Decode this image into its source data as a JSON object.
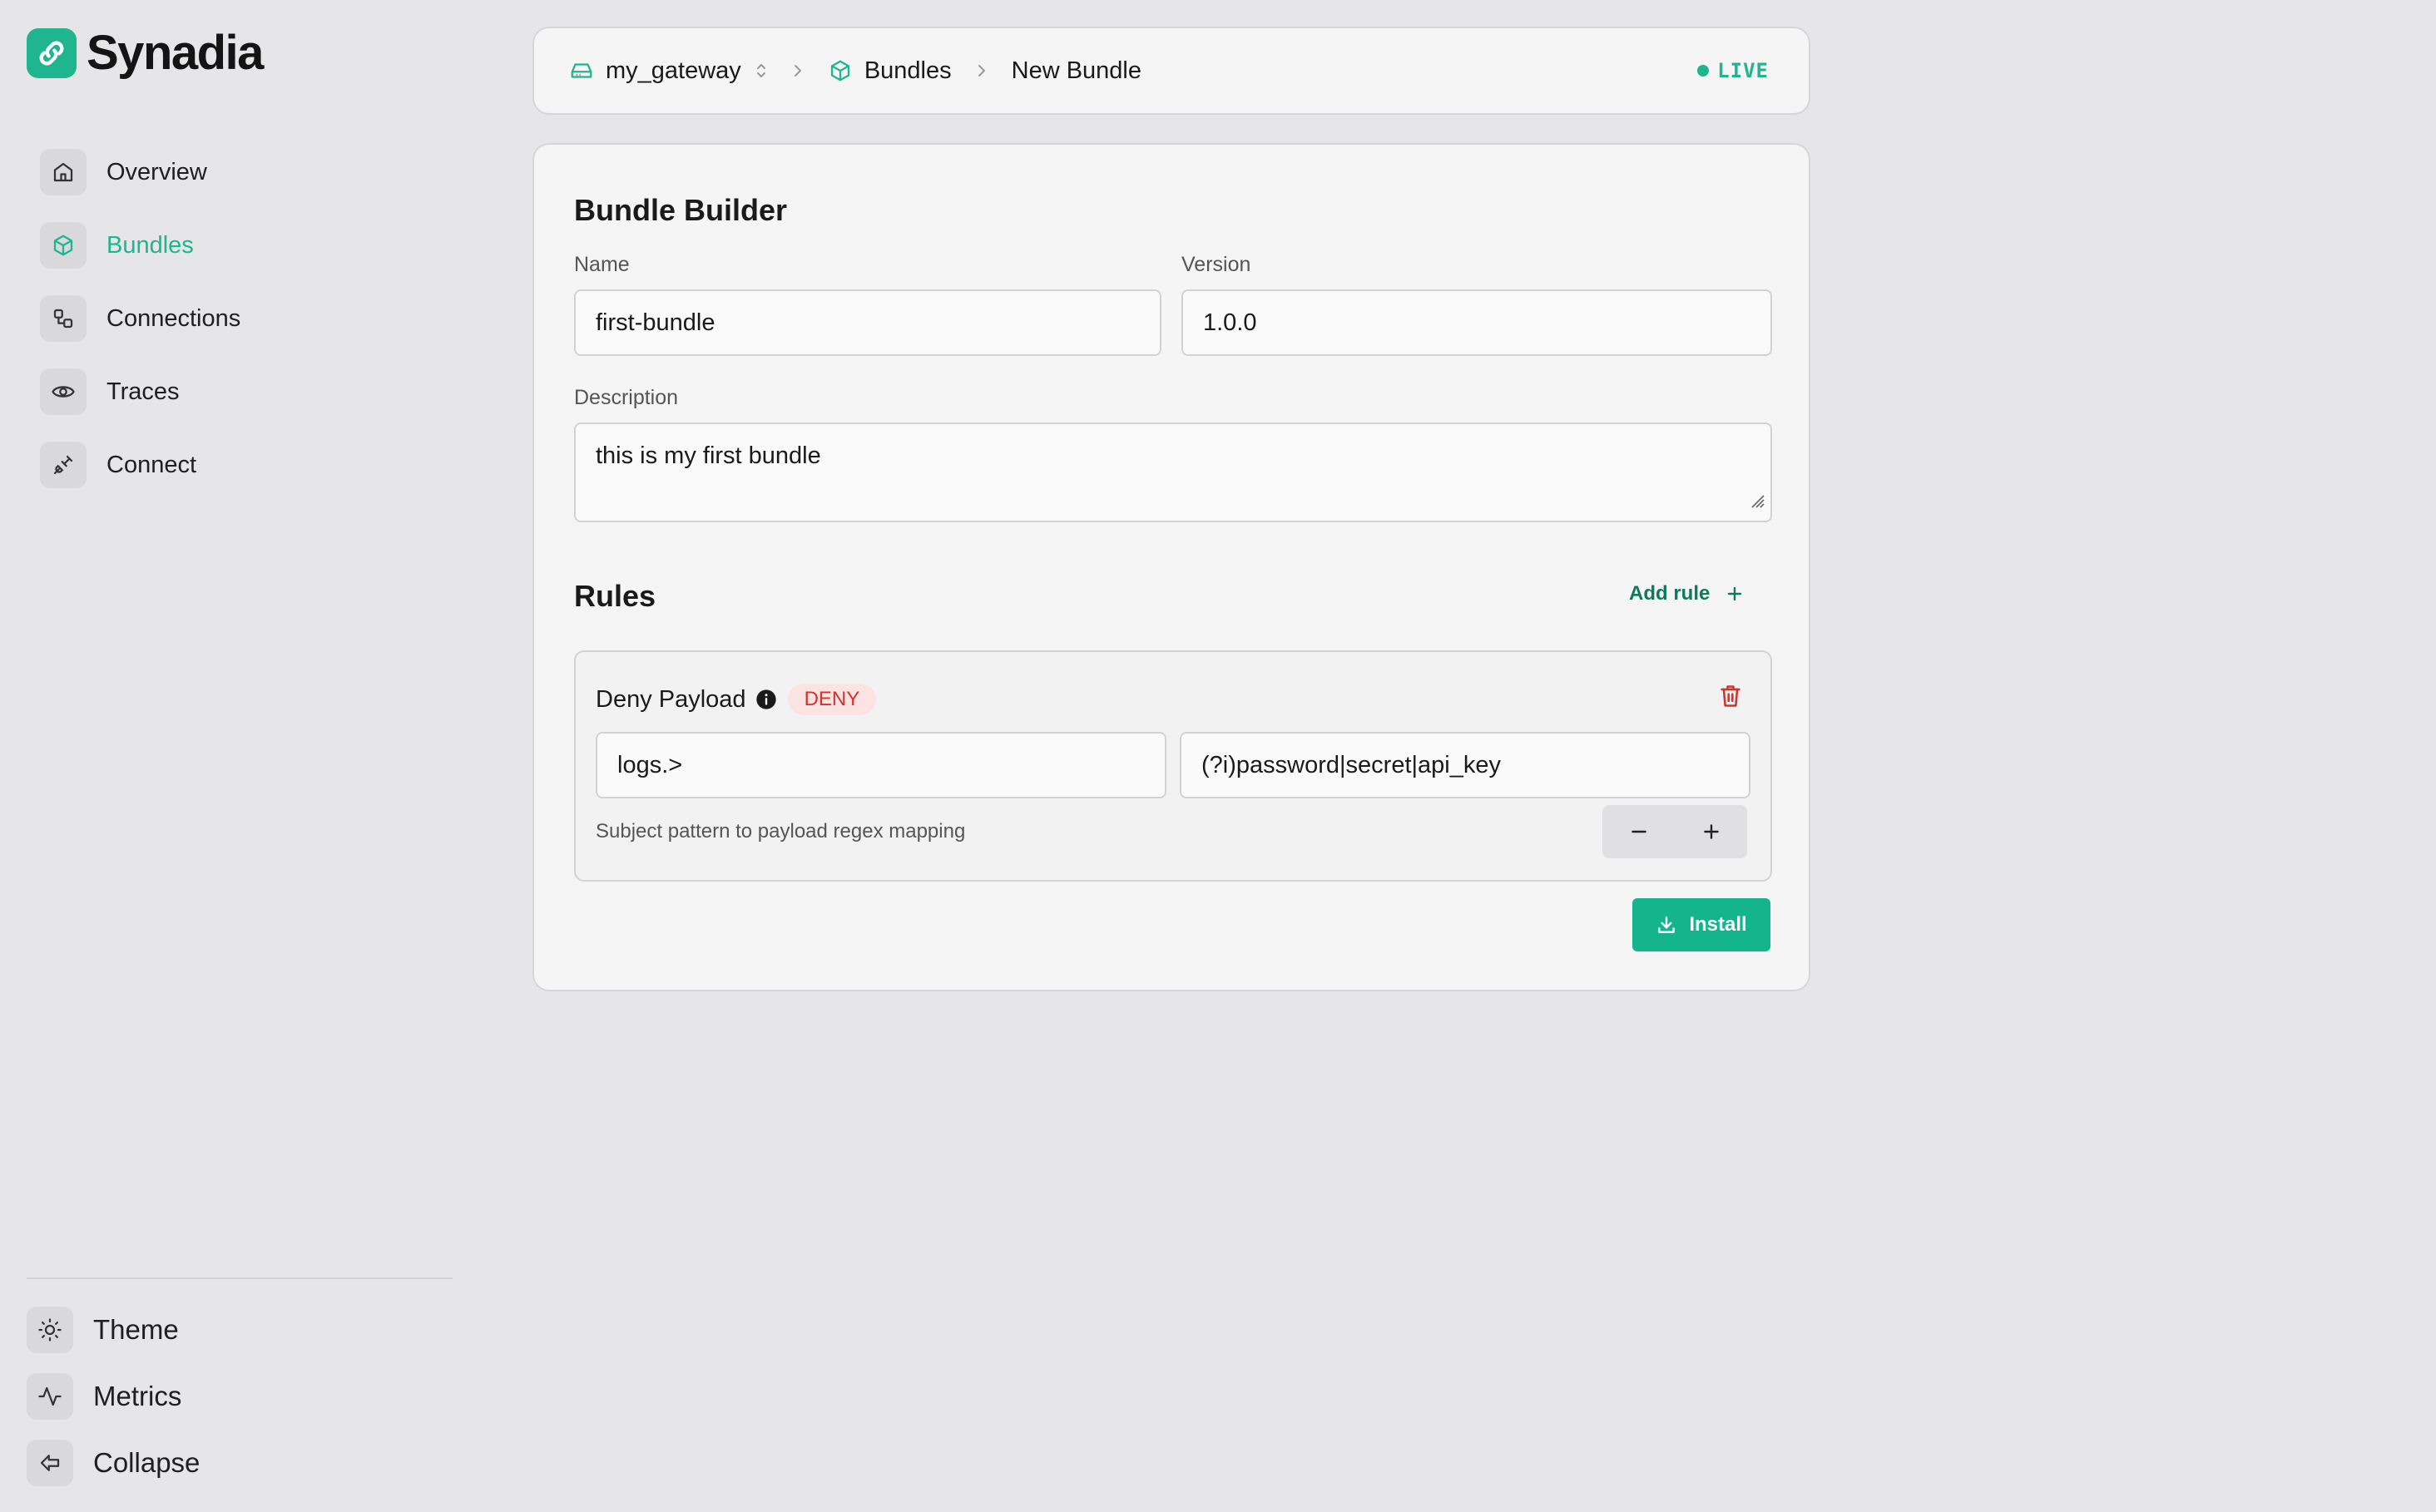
{
  "app": {
    "name": "Synadia"
  },
  "sidebar": {
    "items": [
      {
        "label": "Overview",
        "icon": "home-icon",
        "active": false
      },
      {
        "label": "Bundles",
        "icon": "cube-icon",
        "active": true
      },
      {
        "label": "Connections",
        "icon": "connections-icon",
        "active": false
      },
      {
        "label": "Traces",
        "icon": "eye-icon",
        "active": false
      },
      {
        "label": "Connect",
        "icon": "plug-icon",
        "active": false
      }
    ],
    "bottom": [
      {
        "label": "Theme",
        "icon": "sun-icon"
      },
      {
        "label": "Metrics",
        "icon": "activity-icon"
      },
      {
        "label": "Collapse",
        "icon": "collapse-icon"
      }
    ]
  },
  "breadcrumb": {
    "gateway": "my_gateway",
    "section": "Bundles",
    "page": "New Bundle",
    "status": "LIVE"
  },
  "form": {
    "title": "Bundle Builder",
    "name_label": "Name",
    "name_value": "first-bundle",
    "version_label": "Version",
    "version_value": "1.0.0",
    "description_label": "Description",
    "description_value": "this is my first bundle"
  },
  "rules": {
    "title": "Rules",
    "add_label": "Add rule",
    "items": [
      {
        "name": "Deny Payload",
        "badge": "DENY",
        "subject": "logs.>",
        "regex": "(?i)password|secret|api_key",
        "hint": "Subject pattern to payload regex mapping"
      }
    ]
  },
  "actions": {
    "install_label": "Install"
  },
  "colors": {
    "accent": "#1fb58f",
    "deny": "#d0342c",
    "deny_bg": "#fbe3e3",
    "background": "#e6e6e8"
  }
}
